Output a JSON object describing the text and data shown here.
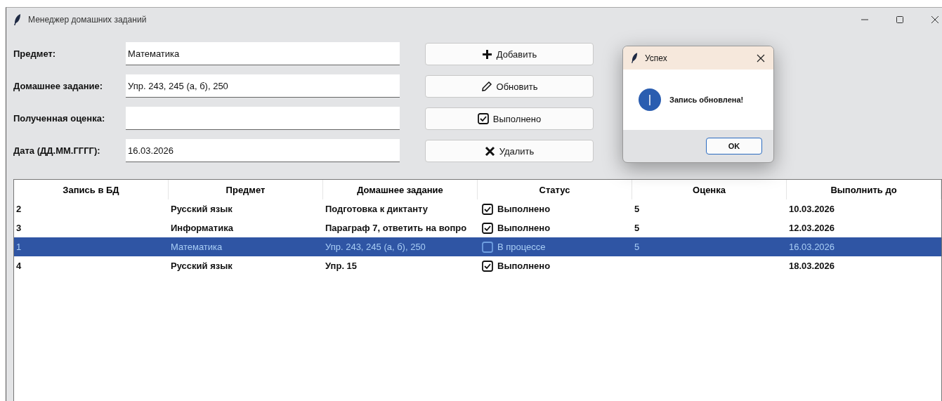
{
  "window": {
    "title": "Менеджер домашних заданий"
  },
  "form": [
    {
      "label": "Предмет:",
      "value": "Математика"
    },
    {
      "label": "Домашнее задание:",
      "value": "Упр. 243, 245 (а, б), 250"
    },
    {
      "label": "Полученная оценка:"
    },
    {
      "label": "Дата (ДД.ММ.ГГГГ):",
      "value": "16.03.2026"
    }
  ],
  "buttons": [
    {
      "kind": "add",
      "label": "Добавить"
    },
    {
      "kind": "edit",
      "label": "Обновить"
    },
    {
      "kind": "done",
      "label": "Выполнено"
    },
    {
      "kind": "delete",
      "label": "Удалить"
    }
  ],
  "table": {
    "columns": [
      "Запись в БД",
      "Предмет",
      "Домашнее задание",
      "Статус",
      "Оценка",
      "Выполнить до"
    ],
    "rows": [
      {
        "selected": false,
        "id": "2",
        "subject": "Русский язык",
        "task": "Подготовка к диктанту",
        "status": {
          "checked": true,
          "label": "Выполнено"
        },
        "grade": "5",
        "due": "10.03.2026"
      },
      {
        "selected": false,
        "id": "3",
        "subject": "Информатика",
        "task": "Параграф 7, ответить на вопро",
        "status": {
          "checked": true,
          "label": "Выполнено"
        },
        "grade": "5",
        "due": "12.03.2026"
      },
      {
        "selected": true,
        "id": "1",
        "subject": "Математика",
        "task": "Упр. 243, 245 (а, б), 250",
        "status": {
          "checked": false,
          "label": "В процессе"
        },
        "grade": "5",
        "due": "16.03.2026"
      },
      {
        "selected": false,
        "id": "4",
        "subject": "Русский язык",
        "task": "Упр. 15",
        "status": {
          "checked": true,
          "label": "Выполнено"
        },
        "due": "18.03.2026"
      }
    ]
  },
  "dialog": {
    "title": "Успех",
    "message": "Запись обновлена!",
    "button": "OK"
  }
}
